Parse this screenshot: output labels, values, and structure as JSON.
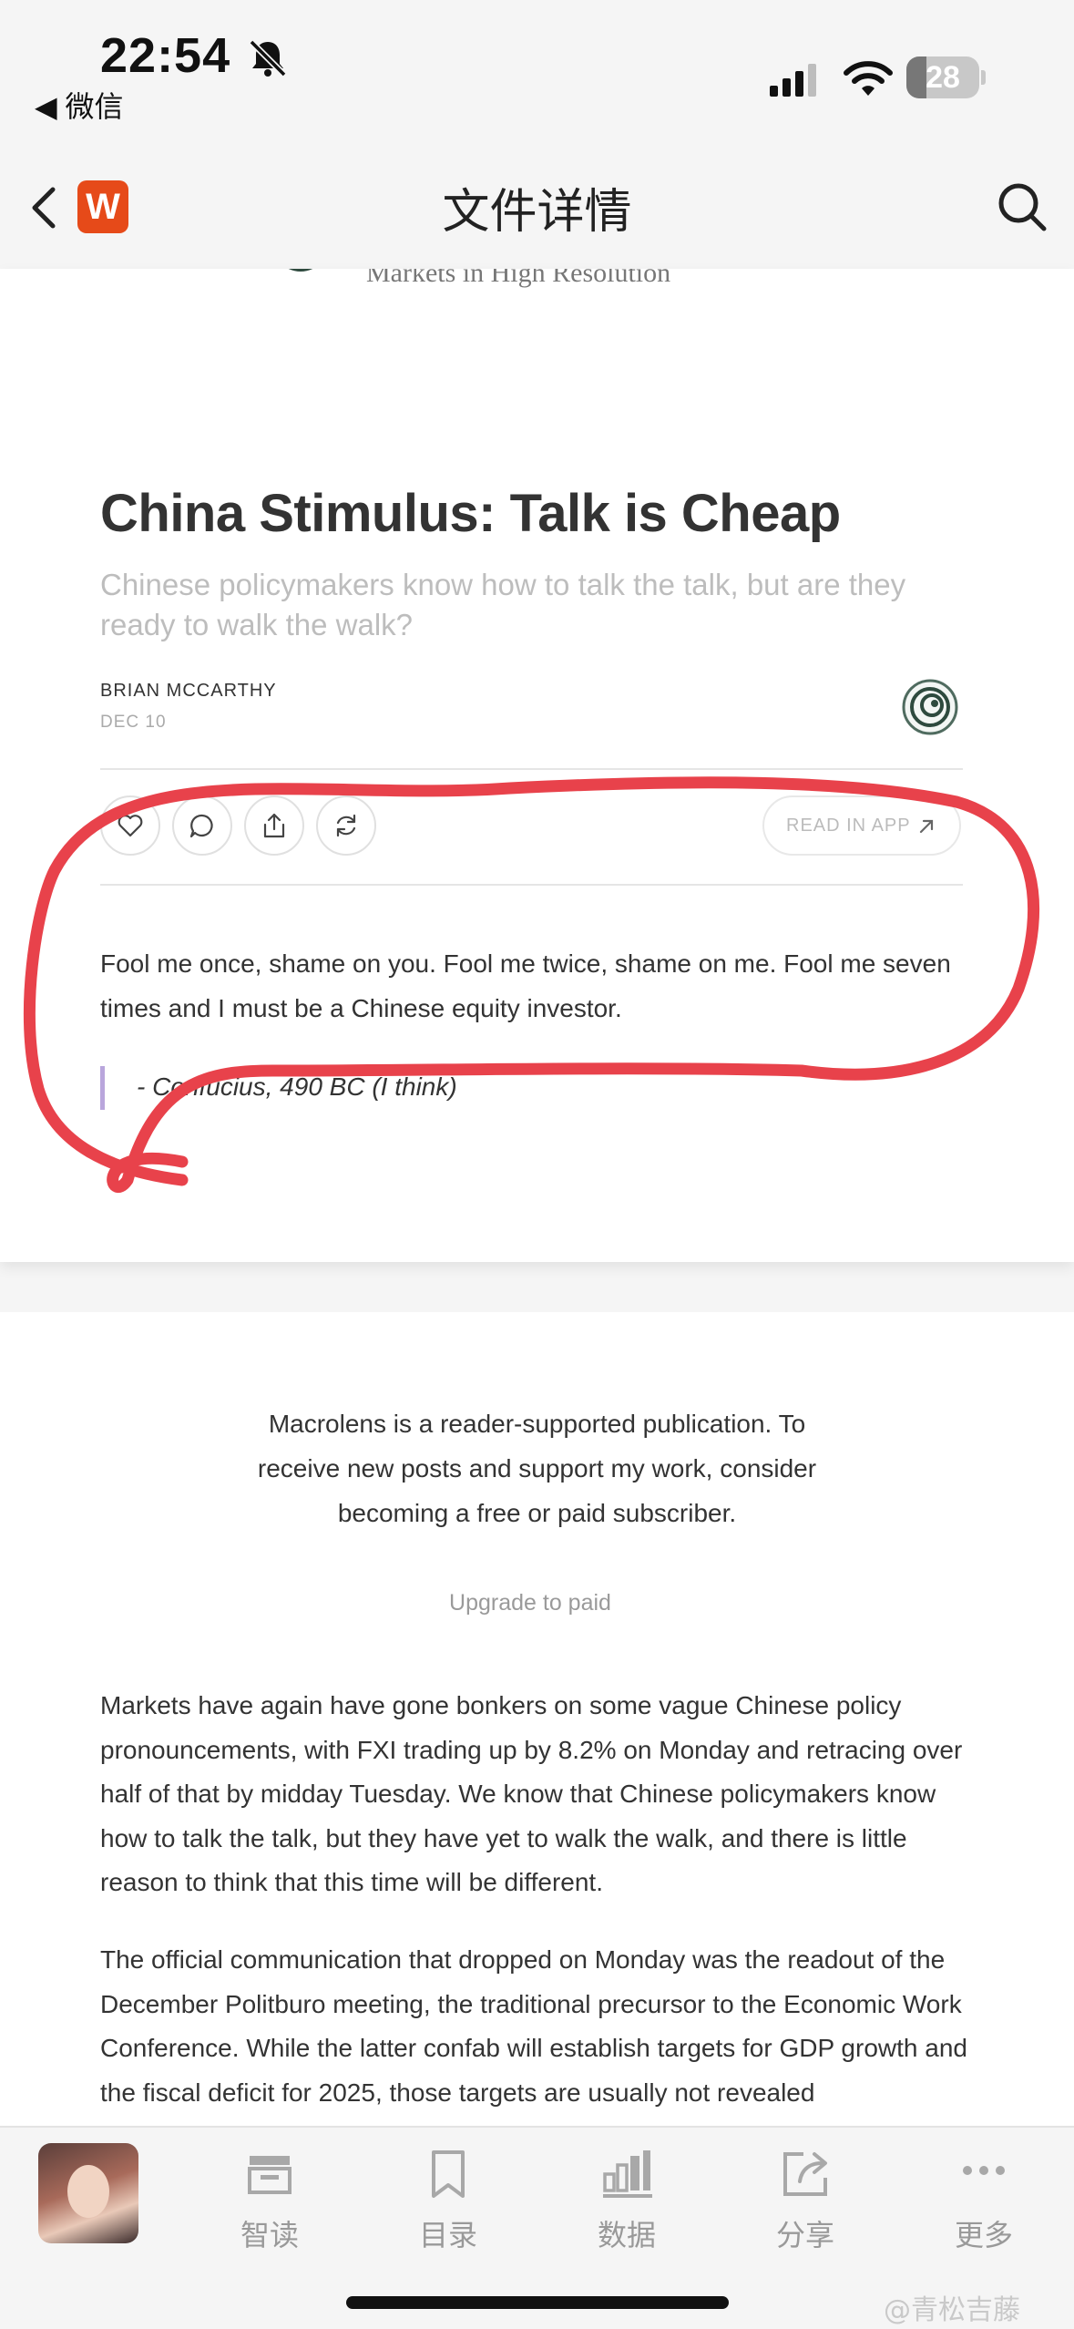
{
  "status_bar": {
    "time": "22:54",
    "back_app": "◀ 微信",
    "battery": "28",
    "battery_level": 0.28
  },
  "nav": {
    "title": "文件详情",
    "app_badge": "W"
  },
  "article": {
    "publication_tagline": "Markets in High Resolution",
    "title": "China Stimulus: Talk is Cheap",
    "subtitle": "Chinese policymakers know how to talk the talk, but are they ready to walk the walk?",
    "author": "BRIAN MCCARTHY",
    "date": "DEC 10",
    "read_in_app": "READ IN APP",
    "quote": "Fool me once, shame on you. Fool me twice, shame on me. Fool me seven times and I must be a Chinese equity investor.",
    "quote_attribution": "- Confucius, 490 BC (I think)"
  },
  "subscribe": {
    "text": "Macrolens is a reader-supported publication. To receive new posts and support my work, consider becoming a free or paid subscriber.",
    "upgrade": "Upgrade to paid"
  },
  "body": {
    "paragraph_1": "Markets have again have gone bonkers on some vague Chinese policy pronouncements, with FXI trading up by 8.2% on Monday and retracing over half of that by midday Tuesday. We know that Chinese policymakers know how to talk the talk, but they have yet to walk the walk, and there is little reason to think that this time will be different.",
    "paragraph_2": "The official communication that dropped on Monday was the readout of the December Politburo meeting, the traditional precursor to the Economic Work Conference. While the latter confab will establish targets for GDP growth and the fiscal deficit for 2025, those targets are usually not revealed"
  },
  "toolbar": {
    "items": [
      {
        "label": "智读",
        "icon": "smart-read-icon"
      },
      {
        "label": "目录",
        "icon": "bookmark-icon"
      },
      {
        "label": "数据",
        "icon": "bar-chart-icon"
      },
      {
        "label": "分享",
        "icon": "share-icon"
      },
      {
        "label": "更多",
        "icon": "more-icon"
      }
    ]
  },
  "watermark": "@青松吉藤",
  "colors": {
    "highlight_red": "#e8424b",
    "quote_bar": "#b9a6dc",
    "app_badge": "#e64a19"
  }
}
